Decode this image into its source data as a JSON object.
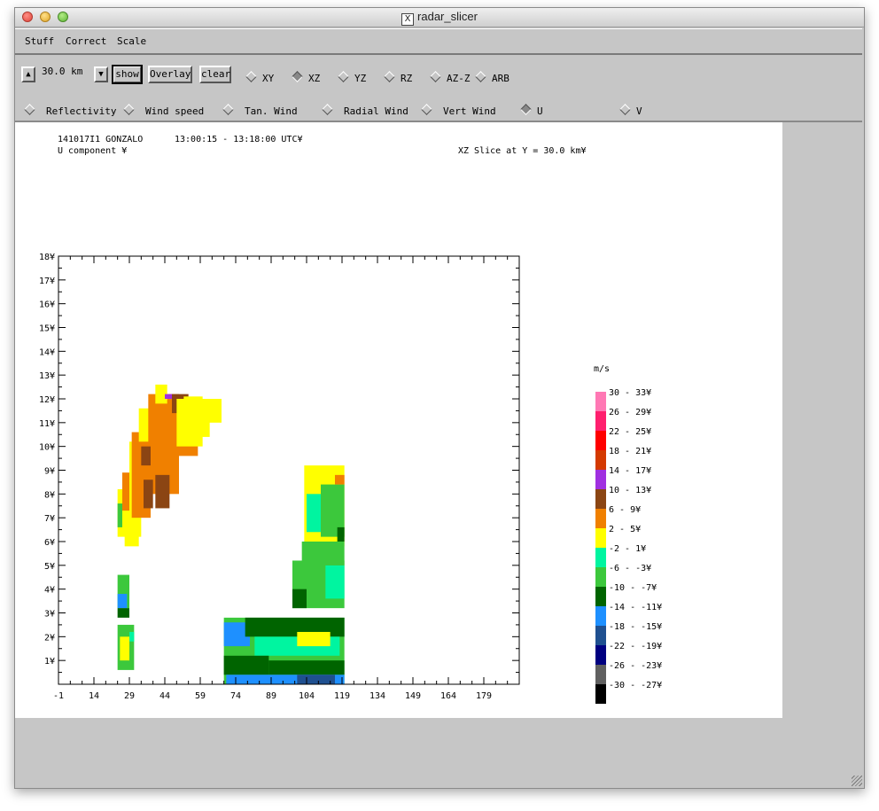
{
  "window": {
    "title": "radar_slicer"
  },
  "menu": [
    "Stuff",
    "Correct",
    "Scale"
  ],
  "toolbar": {
    "level_value": "30.0 km",
    "show_label": "show",
    "overlay_label": "Overlay",
    "clear_label": "clear",
    "slice_modes": [
      "XY",
      "XZ",
      "YZ",
      "RZ",
      "AZ-Z",
      "ARB"
    ],
    "selected_slice_mode": "XZ",
    "fields": [
      "Reflectivity",
      "Wind speed",
      "Tan. Wind",
      "Radial Wind",
      "Vert Wind",
      "U",
      "V"
    ],
    "selected_field": "U"
  },
  "plot_header": {
    "storm": "141017I1 GONZALO",
    "time_range": "13:00:15 - 13:18:00 UTC¥",
    "field_label": "U component ¥",
    "slice_label": "XZ Slice at Y = 30.0 km¥"
  },
  "chart_data": {
    "type": "heatmap",
    "title": "",
    "xlabel": "",
    "ylabel": "",
    "x_ticks": [
      "-1",
      "14",
      "29",
      "44",
      "59",
      "74",
      "89",
      "104",
      "119",
      "134",
      "149",
      "164",
      "179"
    ],
    "y_ticks": [
      "1¥",
      "2¥",
      "3¥",
      "4¥",
      "5¥",
      "6¥",
      "7¥",
      "8¥",
      "9¥",
      "10¥",
      "11¥",
      "12¥",
      "13¥",
      "14¥",
      "15¥",
      "16¥",
      "17¥",
      "18¥"
    ],
    "xlim": [
      -1,
      194
    ],
    "ylim": [
      0,
      18
    ],
    "legend_unit": "m/s",
    "legend_position": "right",
    "legend": [
      {
        "label": "30 - 33¥",
        "color": "#ff78b4"
      },
      {
        "label": "26 - 29¥",
        "color": "#ff1f6e"
      },
      {
        "label": "22 - 25¥",
        "color": "#ff0000"
      },
      {
        "label": "18 - 21¥",
        "color": "#d43a00"
      },
      {
        "label": "14 - 17¥",
        "color": "#a030e0"
      },
      {
        "label": "10 - 13¥",
        "color": "#8b4513"
      },
      {
        "label": "6 - 9¥",
        "color": "#f08000"
      },
      {
        "label": "2 - 5¥",
        "color": "#ffff00"
      },
      {
        "label": "-2 - 1¥",
        "color": "#00f5a0"
      },
      {
        "label": "-6 - -3¥",
        "color": "#3cc83c"
      },
      {
        "label": "-10 - -7¥",
        "color": "#006400"
      },
      {
        "label": "-14 - -11¥",
        "color": "#1e90ff"
      },
      {
        "label": "-18 - -15¥",
        "color": "#1f5090"
      },
      {
        "label": "-22 - -19¥",
        "color": "#000080"
      },
      {
        "label": "-26 - -23¥",
        "color": "#606060"
      },
      {
        "label": "-30 - -27¥",
        "color": "#000000"
      }
    ],
    "cells": [
      {
        "x0": 24,
        "x1": 30,
        "y0": 6.2,
        "y1": 8.2,
        "color": "#ffff00"
      },
      {
        "x0": 24,
        "x1": 26,
        "y0": 6.6,
        "y1": 7.6,
        "color": "#3cc83c"
      },
      {
        "x0": 27,
        "x1": 33,
        "y0": 5.8,
        "y1": 7.6,
        "color": "#ffff00"
      },
      {
        "x0": 26,
        "x1": 29,
        "y0": 7.3,
        "y1": 8.9,
        "color": "#f08000"
      },
      {
        "x0": 29,
        "x1": 34,
        "y0": 6.2,
        "y1": 10.2,
        "color": "#ffff00"
      },
      {
        "x0": 30,
        "x1": 38,
        "y0": 7.0,
        "y1": 10.6,
        "color": "#f08000"
      },
      {
        "x0": 33,
        "x1": 39,
        "y0": 10.2,
        "y1": 11.6,
        "color": "#ffff00"
      },
      {
        "x0": 37,
        "x1": 50,
        "y0": 8.0,
        "y1": 12.2,
        "color": "#f08000"
      },
      {
        "x0": 40,
        "x1": 45,
        "y0": 11.8,
        "y1": 12.6,
        "color": "#ffff00"
      },
      {
        "x0": 45,
        "x1": 58,
        "y0": 9.6,
        "y1": 11.6,
        "color": "#f08000"
      },
      {
        "x0": 47,
        "x1": 54,
        "y0": 11.4,
        "y1": 12.2,
        "color": "#8b4513"
      },
      {
        "x0": 49,
        "x1": 60,
        "y0": 10.0,
        "y1": 12.0,
        "color": "#ffff00"
      },
      {
        "x0": 52,
        "x1": 60,
        "y0": 11.5,
        "y1": 12.1,
        "color": "#ffff00"
      },
      {
        "x0": 55,
        "x1": 63,
        "y0": 10.4,
        "y1": 11.8,
        "color": "#ffff00"
      },
      {
        "x0": 59,
        "x1": 68,
        "y0": 11.0,
        "y1": 12.0,
        "color": "#ffff00"
      },
      {
        "x0": 35,
        "x1": 39,
        "y0": 7.4,
        "y1": 8.6,
        "color": "#8b4513"
      },
      {
        "x0": 40,
        "x1": 46,
        "y0": 7.4,
        "y1": 8.8,
        "color": "#8b4513"
      },
      {
        "x0": 34,
        "x1": 38,
        "y0": 9.2,
        "y1": 10.0,
        "color": "#8b4513"
      },
      {
        "x0": 44,
        "x1": 47,
        "y0": 12.0,
        "y1": 12.2,
        "color": "#a030e0"
      },
      {
        "x0": 24,
        "x1": 29,
        "y0": 3.2,
        "y1": 4.6,
        "color": "#3cc83c"
      },
      {
        "x0": 24,
        "x1": 28,
        "y0": 3.2,
        "y1": 3.8,
        "color": "#1e90ff"
      },
      {
        "x0": 24,
        "x1": 29,
        "y0": 2.8,
        "y1": 3.2,
        "color": "#006400"
      },
      {
        "x0": 24,
        "x1": 31,
        "y0": 0.6,
        "y1": 2.5,
        "color": "#3cc83c"
      },
      {
        "x0": 25,
        "x1": 29,
        "y0": 1.0,
        "y1": 2.0,
        "color": "#ffff00"
      },
      {
        "x0": 29,
        "x1": 31,
        "y0": 1.8,
        "y1": 2.2,
        "color": "#00f5a0"
      },
      {
        "x0": 103,
        "x1": 120,
        "y0": 5.8,
        "y1": 9.2,
        "color": "#ffff00"
      },
      {
        "x0": 104,
        "x1": 113,
        "y0": 6.4,
        "y1": 8.0,
        "color": "#00f5a0"
      },
      {
        "x0": 110,
        "x1": 120,
        "y0": 6.2,
        "y1": 8.4,
        "color": "#3cc83c"
      },
      {
        "x0": 116,
        "x1": 120,
        "y0": 8.4,
        "y1": 8.8,
        "color": "#f08000"
      },
      {
        "x0": 117,
        "x1": 120,
        "y0": 6.0,
        "y1": 6.6,
        "color": "#006400"
      },
      {
        "x0": 98,
        "x1": 120,
        "y0": 3.2,
        "y1": 5.2,
        "color": "#3cc83c"
      },
      {
        "x0": 98,
        "x1": 104,
        "y0": 3.2,
        "y1": 4.0,
        "color": "#006400"
      },
      {
        "x0": 112,
        "x1": 120,
        "y0": 3.6,
        "y1": 5.0,
        "color": "#00f5a0"
      },
      {
        "x0": 102,
        "x1": 120,
        "y0": 5.0,
        "y1": 6.0,
        "color": "#3cc83c"
      },
      {
        "x0": 69,
        "x1": 120,
        "y0": 0.0,
        "y1": 2.8,
        "color": "#3cc83c"
      },
      {
        "x0": 69,
        "x1": 80,
        "y0": 1.6,
        "y1": 2.6,
        "color": "#1e90ff"
      },
      {
        "x0": 78,
        "x1": 120,
        "y0": 2.0,
        "y1": 2.8,
        "color": "#006400"
      },
      {
        "x0": 82,
        "x1": 118,
        "y0": 1.2,
        "y1": 2.0,
        "color": "#00f5a0"
      },
      {
        "x0": 100,
        "x1": 114,
        "y0": 1.6,
        "y1": 2.2,
        "color": "#ffff00"
      },
      {
        "x0": 69,
        "x1": 88,
        "y0": 0.4,
        "y1": 1.2,
        "color": "#006400"
      },
      {
        "x0": 88,
        "x1": 120,
        "y0": 0.4,
        "y1": 1.0,
        "color": "#006400"
      },
      {
        "x0": 70,
        "x1": 120,
        "y0": 0.0,
        "y1": 0.4,
        "color": "#1e90ff"
      },
      {
        "x0": 100,
        "x1": 116,
        "y0": 0.0,
        "y1": 0.4,
        "color": "#1f5090"
      }
    ]
  }
}
